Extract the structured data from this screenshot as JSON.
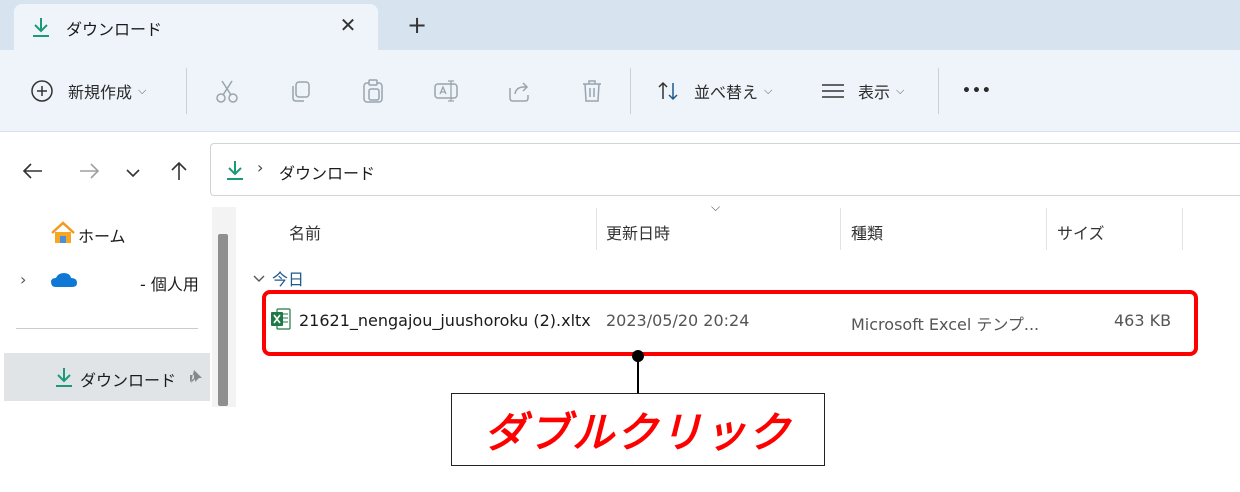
{
  "tab": {
    "title": "ダウンロード",
    "close_glyph": "✕",
    "new_tab_glyph": "+"
  },
  "toolbar": {
    "new_label": "新規作成",
    "sort_label": "並べ替え",
    "view_label": "表示",
    "more_glyph": "•••",
    "caret": "⌵"
  },
  "address": {
    "separator": "›",
    "path": "ダウンロード"
  },
  "sidebar": {
    "home": "ホーム",
    "onedrive": "- 個人用",
    "downloads": "ダウンロード",
    "expand_glyph": "›"
  },
  "columns": {
    "name": "名前",
    "modified": "更新日時",
    "type": "種類",
    "size": "サイズ"
  },
  "group": {
    "label": "今日"
  },
  "file": {
    "name": "21621_nengajou_juushoroku (2).xltx",
    "modified": "2023/05/20 20:24",
    "type": "Microsoft Excel テンプ...",
    "size": "463 KB"
  },
  "annotation": {
    "text": "ダブルクリック",
    "color": "#ff0000"
  },
  "colors": {
    "accent": "#1a9a7a",
    "highlight": "#ff0000",
    "excel": "#1d7a45"
  }
}
